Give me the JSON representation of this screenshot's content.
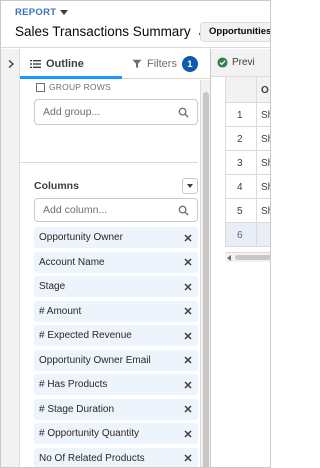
{
  "header": {
    "report_label": "REPORT",
    "title": "Sales Transactions Summary",
    "report_type": "Opportunities"
  },
  "panel": {
    "tabs": {
      "outline": "Outline",
      "filters": "Filters",
      "filters_count": "1"
    },
    "group_rows_label": "GROUP ROWS",
    "group_placeholder": "Add group...",
    "columns_title": "Columns",
    "column_placeholder": "Add column...",
    "columns": [
      "Opportunity Owner",
      "Account Name",
      "Stage",
      "# Amount",
      "# Expected Revenue",
      "Opportunity Owner Email",
      "# Has Products",
      "# Stage Duration",
      "# Opportunity Quantity",
      "No Of Related Products"
    ]
  },
  "preview": {
    "tab_label": "Previ",
    "column_header": "O",
    "row_numbers": [
      "1",
      "2",
      "3",
      "4",
      "5",
      "6"
    ],
    "row_values": [
      "Sh",
      "Sh",
      "Sh",
      "Sh",
      "Sh",
      ""
    ]
  },
  "colors": {
    "accent": "#1b96ff",
    "badge": "#0b5cab",
    "link": "#3b6fc4",
    "success": "#2e844a"
  },
  "icons": [
    "pencil-icon",
    "outline-icon",
    "filter-icon",
    "search-icon",
    "remove-icon",
    "check-icon",
    "chevron-right-icon"
  ]
}
